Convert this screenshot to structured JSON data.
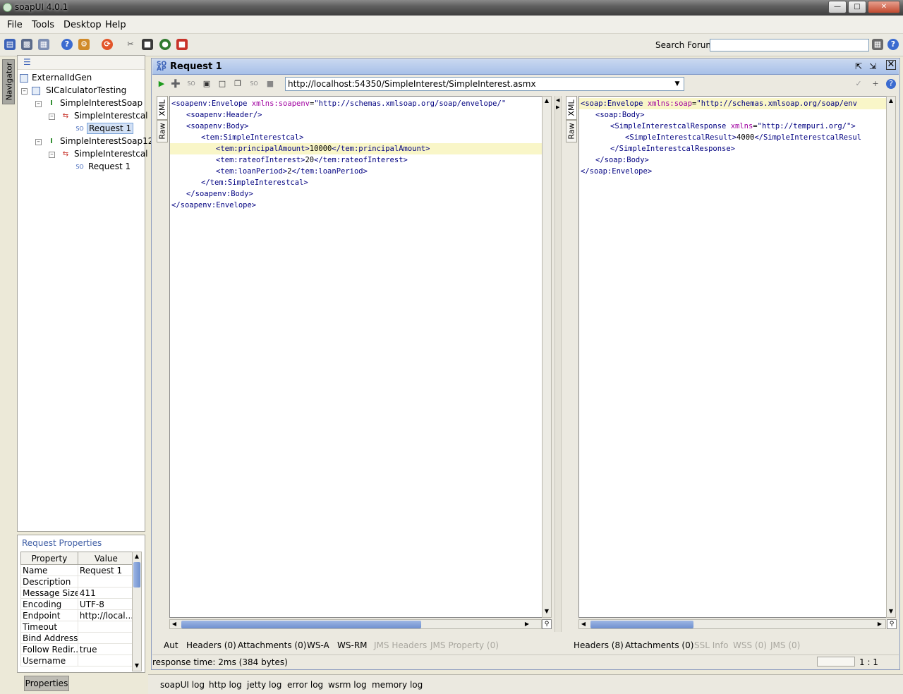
{
  "window": {
    "title": "soapUI 4.0.1"
  },
  "menu": [
    "File",
    "Tools",
    "Desktop",
    "Help"
  ],
  "toolbar": {
    "search_label": "Search Forum",
    "search_value": ""
  },
  "navigator": {
    "tab_label": "Navigator",
    "tree": [
      {
        "label": "ExternalIdGen",
        "icon": "project-icon"
      },
      {
        "label": "SICalculatorTesting",
        "icon": "project-icon"
      },
      {
        "label": "SimpleInterestSoap",
        "icon": "interface-icon"
      },
      {
        "label": "SimpleInterestcal",
        "icon": "operation-icon"
      },
      {
        "label": "Request 1",
        "icon": "request-icon",
        "selected": true
      },
      {
        "label": "SimpleInterestSoap12",
        "icon": "interface-icon"
      },
      {
        "label": "SimpleInterestcal",
        "icon": "operation-icon"
      },
      {
        "label": "Request 1",
        "icon": "request-icon"
      }
    ]
  },
  "properties": {
    "title": "Request Properties",
    "columns": [
      "Property",
      "Value"
    ],
    "rows": [
      [
        "Name",
        "Request 1"
      ],
      [
        "Description",
        ""
      ],
      [
        "Message Size",
        "411"
      ],
      [
        "Encoding",
        "UTF-8"
      ],
      [
        "Endpoint",
        "http://local..."
      ],
      [
        "Timeout",
        ""
      ],
      [
        "Bind Address",
        ""
      ],
      [
        "Follow Redir...",
        "true"
      ],
      [
        "Username",
        ""
      ]
    ],
    "tab_label": "Properties"
  },
  "request": {
    "title": "Request 1",
    "endpoint": "http://localhost:54350/SimpleInterest/SimpleInterest.asmx",
    "left_tabs": [
      "XML",
      "Raw"
    ],
    "right_tabs": [
      "XML",
      "Raw"
    ],
    "request_lines": [
      {
        "indent": 0,
        "parts": [
          [
            "tag",
            "<soapenv:Envelope "
          ],
          [
            "attr",
            "xmlns:soapenv"
          ],
          [
            "txt",
            "="
          ],
          [
            "aval",
            "\"http://schemas.xmlsoap.org/soap/envelope/\""
          ]
        ]
      },
      {
        "indent": 1,
        "parts": [
          [
            "tag",
            "<soapenv:Header/>"
          ]
        ]
      },
      {
        "indent": 1,
        "parts": [
          [
            "tag",
            "<soapenv:Body>"
          ]
        ]
      },
      {
        "indent": 2,
        "parts": [
          [
            "tag",
            "<tem:SimpleInterestcal>"
          ]
        ]
      },
      {
        "indent": 3,
        "parts": [
          [
            "tag",
            "<tem:principalAmount>"
          ],
          [
            "txt",
            "10000"
          ],
          [
            "tag",
            "</tem:principalAmount>"
          ]
        ],
        "highlight": true
      },
      {
        "indent": 3,
        "parts": [
          [
            "tag",
            "<tem:rateofInterest>"
          ],
          [
            "txt",
            "20"
          ],
          [
            "tag",
            "</tem:rateofInterest>"
          ]
        ]
      },
      {
        "indent": 3,
        "parts": [
          [
            "tag",
            "<tem:loanPeriod>"
          ],
          [
            "txt",
            "2"
          ],
          [
            "tag",
            "</tem:loanPeriod>"
          ]
        ]
      },
      {
        "indent": 2,
        "parts": [
          [
            "tag",
            "</tem:SimpleInterestcal>"
          ]
        ]
      },
      {
        "indent": 1,
        "parts": [
          [
            "tag",
            "</soapenv:Body>"
          ]
        ]
      },
      {
        "indent": 0,
        "parts": [
          [
            "tag",
            "</soapenv:Envelope>"
          ]
        ]
      }
    ],
    "response_lines": [
      {
        "indent": 0,
        "parts": [
          [
            "tag",
            "<soap:Envelope "
          ],
          [
            "attr",
            "xmlns:soap"
          ],
          [
            "txt",
            "="
          ],
          [
            "aval",
            "\"http://schemas.xmlsoap.org/soap/env"
          ]
        ],
        "highlight": true
      },
      {
        "indent": 1,
        "parts": [
          [
            "tag",
            "<soap:Body>"
          ]
        ]
      },
      {
        "indent": 2,
        "parts": [
          [
            "tag",
            "<SimpleInterestcalResponse "
          ],
          [
            "attr",
            "xmlns"
          ],
          [
            "txt",
            "="
          ],
          [
            "aval",
            "\"http://tempuri.org/\">"
          ]
        ]
      },
      {
        "indent": 3,
        "parts": [
          [
            "tag",
            "<SimpleInterestcalResult>"
          ],
          [
            "txt",
            "4000"
          ],
          [
            "tag",
            "</SimpleInterestcalResul"
          ]
        ]
      },
      {
        "indent": 2,
        "parts": [
          [
            "tag",
            "</SimpleInterestcalResponse>"
          ]
        ]
      },
      {
        "indent": 1,
        "parts": [
          [
            "tag",
            "</soap:Body>"
          ]
        ]
      },
      {
        "indent": 0,
        "parts": [
          [
            "tag",
            "</soap:Envelope>"
          ]
        ]
      }
    ],
    "request_bottom_tabs": [
      {
        "label": "Aut",
        "enabled": true
      },
      {
        "label": "Headers (0)",
        "enabled": true
      },
      {
        "label": "Attachments (0)",
        "enabled": true
      },
      {
        "label": "WS-A",
        "enabled": true
      },
      {
        "label": "WS-RM",
        "enabled": true
      },
      {
        "label": "JMS Headers",
        "enabled": false
      },
      {
        "label": "JMS Property (0)",
        "enabled": false
      }
    ],
    "response_bottom_tabs": [
      {
        "label": "Headers (8)",
        "enabled": true
      },
      {
        "label": "Attachments (0)",
        "enabled": true
      },
      {
        "label": "SSL Info",
        "enabled": false
      },
      {
        "label": "WSS (0)",
        "enabled": false
      },
      {
        "label": "JMS (0)",
        "enabled": false
      }
    ],
    "status": "response time: 2ms (384 bytes)",
    "cursor_pos": "1 : 1"
  },
  "logs": [
    "soapUI log",
    "http log",
    "jetty log",
    "error log",
    "wsrm log",
    "memory log"
  ]
}
